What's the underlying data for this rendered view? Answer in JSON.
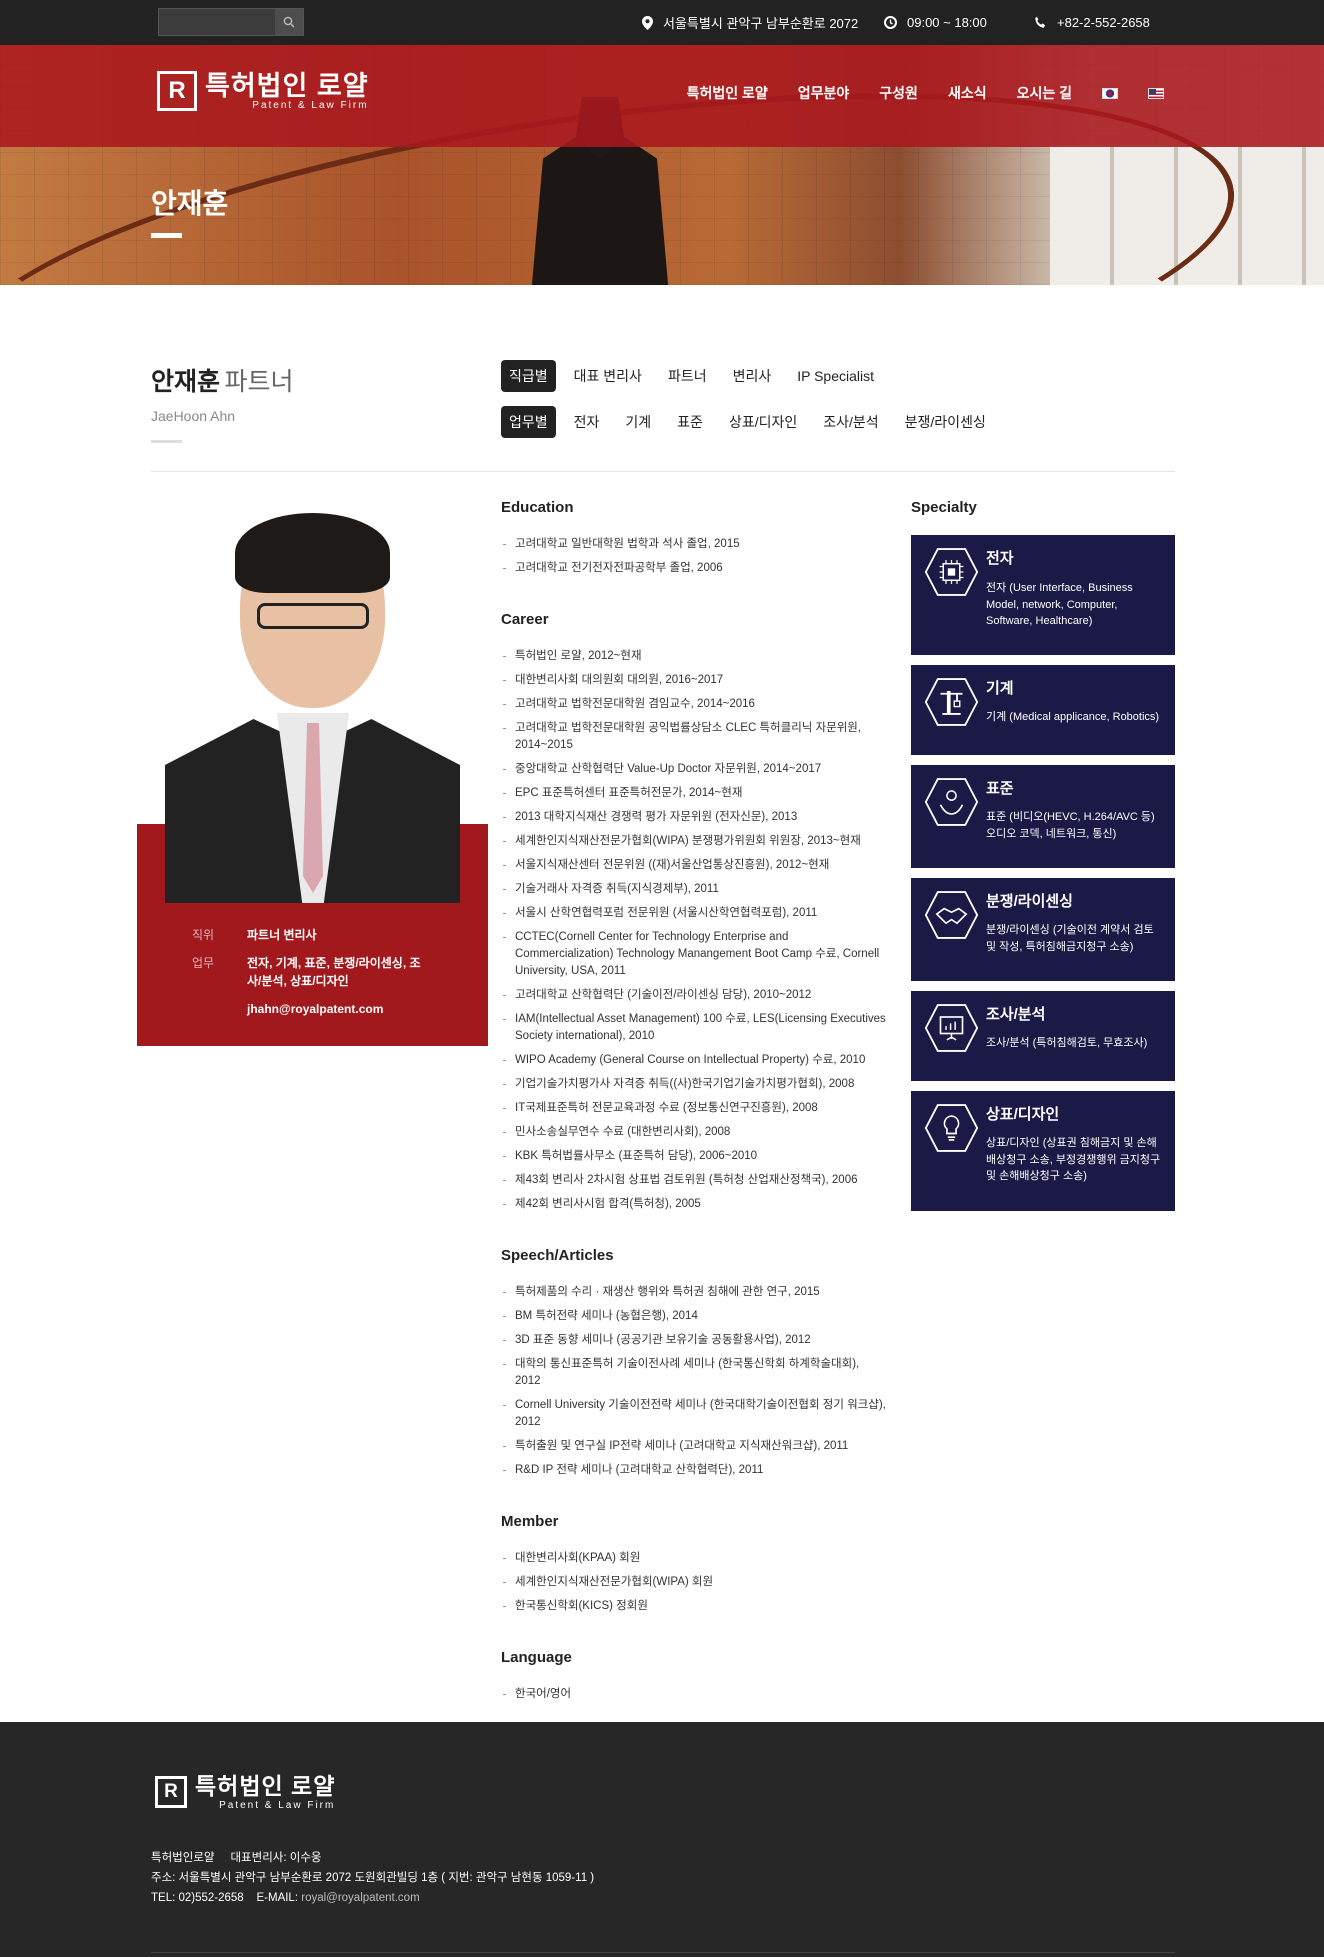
{
  "topbar": {
    "search_placeholder": "",
    "address": "서울특별시 관악구 남부순환로 2072",
    "hours": "09:00 ~ 18:00",
    "phone": "+82-2-552-2658"
  },
  "header": {
    "logo_main": "특허법인 로얄",
    "logo_sub": "Patent & Law Firm",
    "nav": [
      "특허법인 로얄",
      "업무분야",
      "구성원",
      "새소식",
      "오시는 길"
    ]
  },
  "hero": {
    "title": "안재훈"
  },
  "profile": {
    "name": "안재훈",
    "role": "파트너",
    "name_en": "JaeHoon Ahn",
    "position_label": "직위",
    "position_value": "파트너 변리사",
    "work_label": "업무",
    "work_value": "전자, 기계, 표준, 분쟁/라이센싱, 조사/분석, 상표/디자인",
    "email": "jhahn@royalpatent.com"
  },
  "tabs": {
    "rank": [
      "직급별",
      "대표 변리사",
      "파트너",
      "변리사",
      "IP Specialist"
    ],
    "field": [
      "업무별",
      "전자",
      "기계",
      "표준",
      "상표/디자인",
      "조사/분석",
      "분쟁/라이센싱"
    ]
  },
  "education": {
    "title": "Education",
    "items": [
      "고려대학교 일반대학원 법학과 석사 졸업, 2015",
      "고려대학교 전기전자전파공학부 졸업, 2006"
    ]
  },
  "career": {
    "title": "Career",
    "items": [
      "특허법인 로얄, 2012~현재",
      "대한변리사회 대의원회 대의원, 2016~2017",
      "고려대학교 법학전문대학원 겸임교수, 2014~2016",
      "고려대학교 법학전문대학원 공익법률상담소 CLEC 특허클리닉 자문위원, 2014~2015",
      "중앙대학교 산학협력단 Value-Up Doctor 자문위원, 2014~2017",
      "EPC 표준특허센터 표준특허전문가, 2014~현재",
      "2013 대학지식재산 경쟁력 평가 자문위원 (전자신문), 2013",
      "세계한인지식재산전문가협회(WIPA) 분쟁평가위원회 위원장, 2013~현재",
      "서울지식재산센터 전문위원 ((재)서울산업통상진흥원), 2012~현재",
      "기술거래사 자격증 취득(지식경제부), 2011",
      "서울시 산학연협력포럼 전문위원 (서울시산학연협력포럼), 2011",
      "CCTEC(Cornell Center for Technology Enterprise and Commercialization) Technology Manangement Boot Camp 수료, Cornell University, USA, 2011",
      "고려대학교 산학협력단 (기술이전/라이센싱 담당), 2010~2012",
      "IAM(Intellectual Asset Management) 100 수료, LES(Licensing Executives Society international), 2010",
      "WIPO Academy (General Course on Intellectual Property) 수료, 2010",
      "기업기술가치평가사 자격증 취득((사)한국기업기술가치평가협회), 2008",
      "IT국제표준특허 전문교육과정 수료 (정보통신연구진흥원), 2008",
      "민사소송실무연수 수료 (대한변리사회), 2008",
      "KBK 특허법률사무소 (표준특허 담당), 2006~2010",
      "제43회 변리사 2차시험 상표법 검토위원 (특허청 산업재산정책국), 2006",
      "제42회 변리사시험 합격(특허청), 2005"
    ]
  },
  "speech": {
    "title": "Speech/Articles",
    "items": [
      "특허제품의 수리 · 재생산 행위와 특허권 침해에 관한 연구, 2015",
      "BM 특허전략 세미나 (농협은행), 2014",
      "3D 표준 동향 세미나 (공공기관 보유기술 공동활용사업), 2012",
      "대학의 통신표준특허 기술이전사례 세미나 (한국통신학회 하계학술대회), 2012",
      "Cornell University 기술이전전략 세미나 (한국대학기술이전협회 정기 워크샵), 2012",
      "특허출원 및 연구실 IP전략 세미나 (고려대학교 지식재산워크샵), 2011",
      "R&D IP 전략 세미나 (고려대학교 산학협력단), 2011"
    ]
  },
  "member": {
    "title": "Member",
    "items": [
      "대한변리사회(KPAA) 회원",
      "세계한인지식재산전문가협회(WIPA) 회원",
      "한국통신학회(KICS) 정회원"
    ]
  },
  "language": {
    "title": "Language",
    "items": [
      "한국어/영어"
    ]
  },
  "specialty": {
    "title": "Specialty",
    "cards": [
      {
        "title": "전자",
        "desc": "전자 (User Interface, Business Model, network, Computer, Software, Healthcare)",
        "icon": "chip-icon"
      },
      {
        "title": "기계",
        "desc": "기계 (Medical applicance, Robotics)",
        "icon": "crane-icon"
      },
      {
        "title": "표준",
        "desc": "표준 (비디오(HEVC, H.264/AVC 등) 오디오 코덱, 네트워크, 통신)",
        "icon": "hands-gear-icon"
      },
      {
        "title": "분쟁/라이센싱",
        "desc": "분쟁/라이센싱 (기술이전 계약서 검토 및 작성, 특허침해금지청구 소송)",
        "icon": "handshake-icon"
      },
      {
        "title": "조사/분석",
        "desc": "조사/분석 (특허침해검토, 무효조사)",
        "icon": "presentation-icon"
      },
      {
        "title": "상표/디자인",
        "desc": "상표/디자인 (상표권 침해금지 및 손해배상청구 소송, 부정경쟁행위 금지청구 및 손해배상청구 소송)",
        "icon": "lightbulb-icon"
      }
    ]
  },
  "footer": {
    "logo_main": "특허법인 로얄",
    "logo_sub": "Patent & Law Firm",
    "line1": "특허법인로얄     대표변리사: 이수웅",
    "line2": "주소: 서울특별시 관악구 남부순환로 2072 도원회관빌딩 1층 ( 지번: 관악구 남현동 1059-11 )",
    "tel": "TEL: 02)552-2658",
    "email_label": "E-MAIL:",
    "email": "royal@royalpatent.com"
  },
  "colors": {
    "brand_red": "#a1181d",
    "navy": "#1b1a46",
    "dark": "#222222"
  }
}
